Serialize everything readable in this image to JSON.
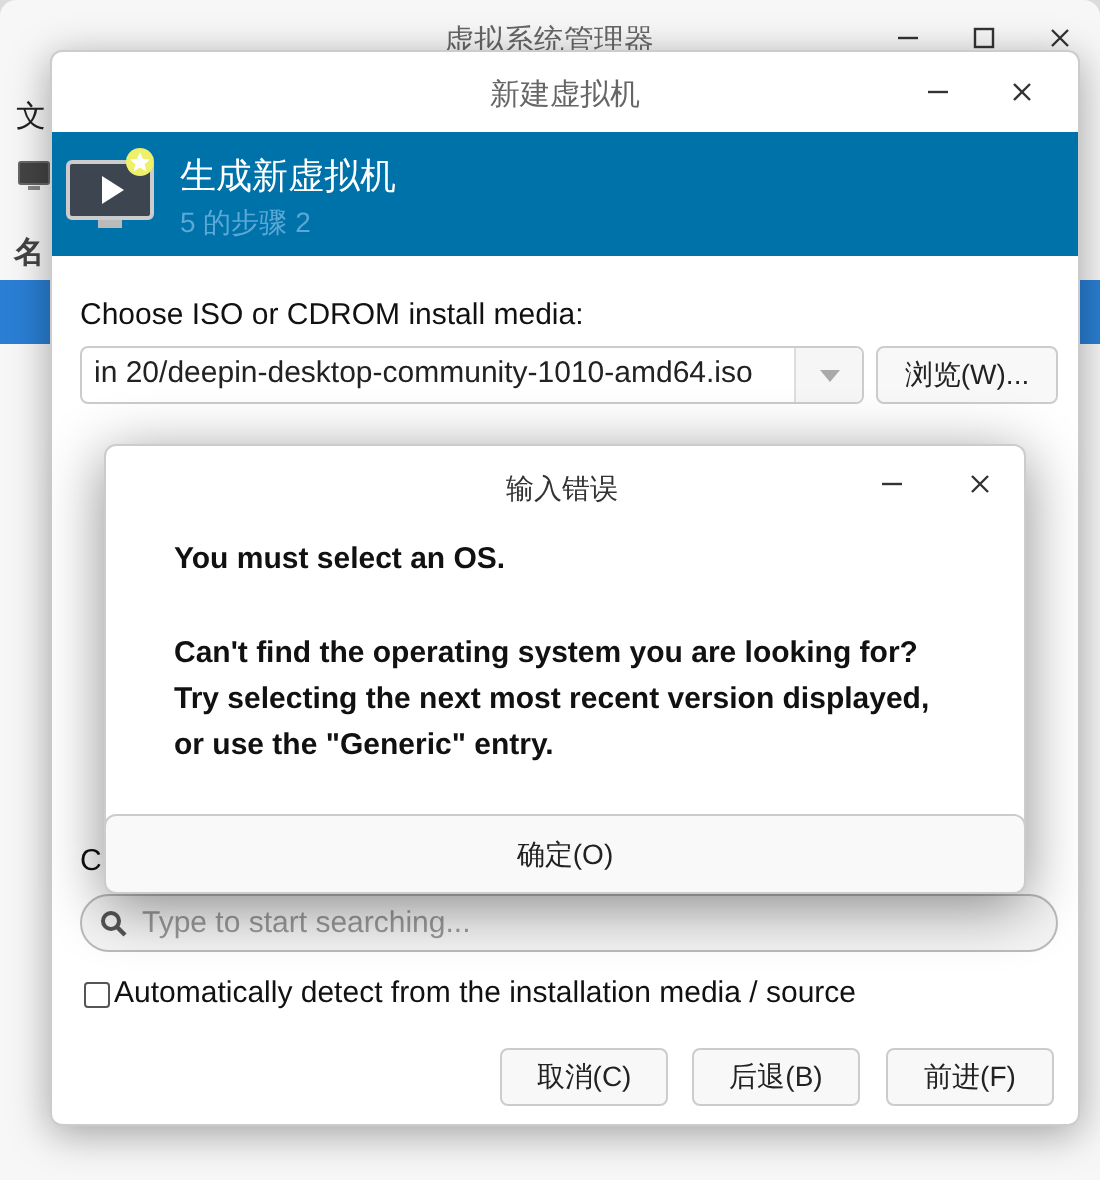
{
  "main_window": {
    "title": "虚拟系统管理器",
    "menu_item": "文",
    "column_header": "名",
    "selected_row": true
  },
  "dialog": {
    "title": "新建虚拟机",
    "header": {
      "title": "生成新虚拟机",
      "subtitle": "5 的步骤 2"
    },
    "media_label": "Choose ISO or CDROM install media:",
    "media_path": "in 20/deepin-desktop-community-1010-amd64.iso",
    "browse_button": "浏览(W)...",
    "os_label": "C",
    "search": {
      "placeholder": "Type to start searching..."
    },
    "auto_detect": {
      "label": "Automatically detect from the installation media / source",
      "checked": false
    },
    "buttons": [
      "取消(C)",
      "后退(B)",
      "前进(F)"
    ]
  },
  "error_dialog": {
    "title": "输入错误",
    "message": "You must select an OS.",
    "details": [
      "Can't find the operating system you are looking for?",
      "Try selecting the next most recent version displayed,",
      "or use the \"Generic\" entry."
    ],
    "ok_button": "确定(O)"
  }
}
